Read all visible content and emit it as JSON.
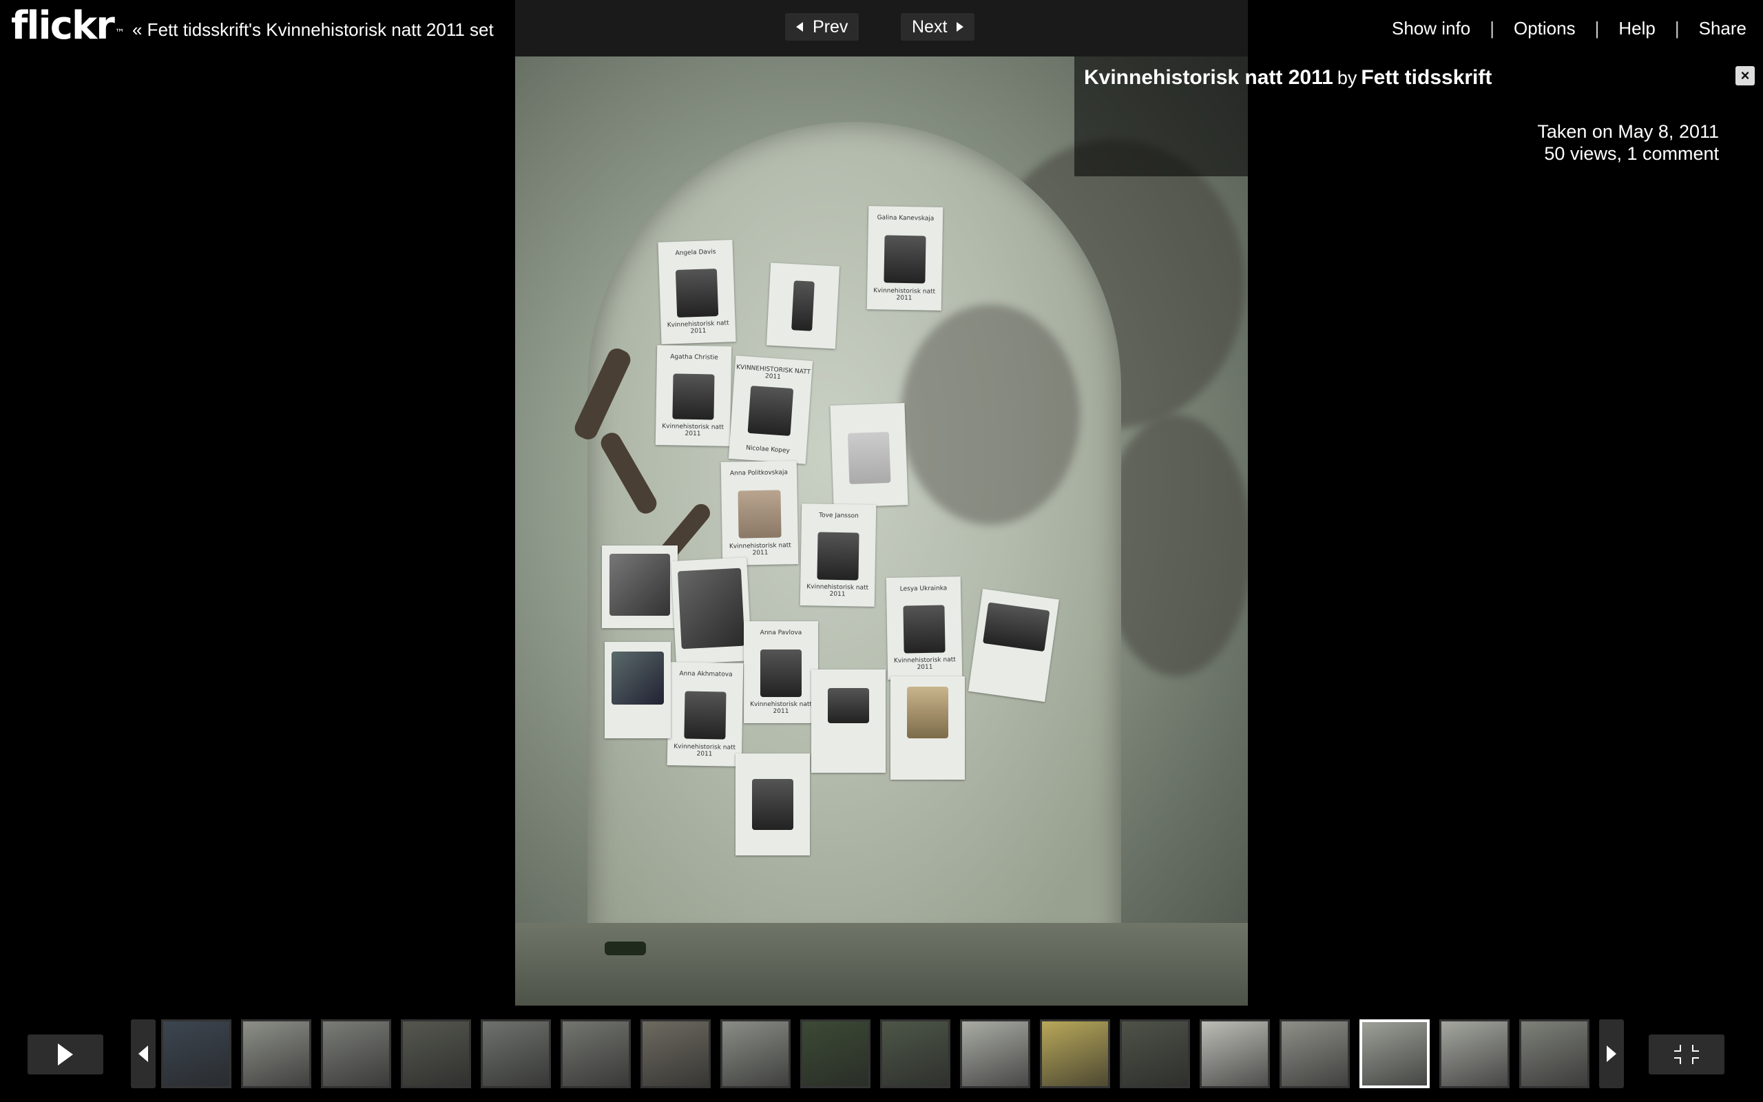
{
  "header": {
    "logo_text": "flickr",
    "logo_tm": "™",
    "set_link": "« Fett tidsskrift's Kvinnehistorisk natt 2011 set",
    "prev_label": "Prev",
    "next_label": "Next",
    "menu": {
      "show_info": "Show info",
      "options": "Options",
      "help": "Help",
      "share": "Share",
      "separator": "|"
    }
  },
  "photo": {
    "title": "Kvinnehistorisk natt 2011",
    "by": "by",
    "owner": "Fett tidsskrift",
    "close_label": "×",
    "taken": "Taken on May 8, 2011",
    "stats": "50 views, 1 comment"
  },
  "posters": [
    {
      "top": "Angela Davis",
      "bot": "Kvinnehistorisk natt 2011"
    },
    {
      "top": "Galina Kanevskaja",
      "bot": "Kvinnehistorisk natt 2011"
    },
    {
      "top": "Agatha Christie",
      "bot": "Kvinnehistorisk natt 2011"
    },
    {
      "top": "KVINNEHISTORISK NATT 2011",
      "bot": "Nicolae Kopey"
    },
    {
      "top": "Anna Politkovskaja",
      "bot": "Kvinnehistorisk natt 2011"
    },
    {
      "top": "Tove Jansson",
      "bot": "Kvinnehistorisk natt 2011"
    },
    {
      "top": "Lesya Ukrainka",
      "bot": "Kvinnehistorisk natt 2011"
    },
    {
      "top": "Anna Pavlova",
      "bot": "Kvinnehistorisk natt 2011"
    },
    {
      "top": "Anna Akhmatova",
      "bot": "Kvinnehistorisk natt 2011"
    }
  ],
  "filmstrip": {
    "thumb_colors": [
      "#3c4550",
      "#8d8f88",
      "#7a7c77",
      "#55574f",
      "#6e716d",
      "#73756f",
      "#6d6a60",
      "#8a8d86",
      "#3c4a35",
      "#4d5648",
      "#a9aba4",
      "#b8a85a",
      "#4e5248",
      "#bcbdb6",
      "#8e8f88",
      "#9ca097",
      "#a4a69f",
      "#7e8079"
    ],
    "active_index": 15
  },
  "colors": {
    "background": "#000000",
    "nav_box": "#1a1a1a",
    "button": "#2d2d2d"
  }
}
